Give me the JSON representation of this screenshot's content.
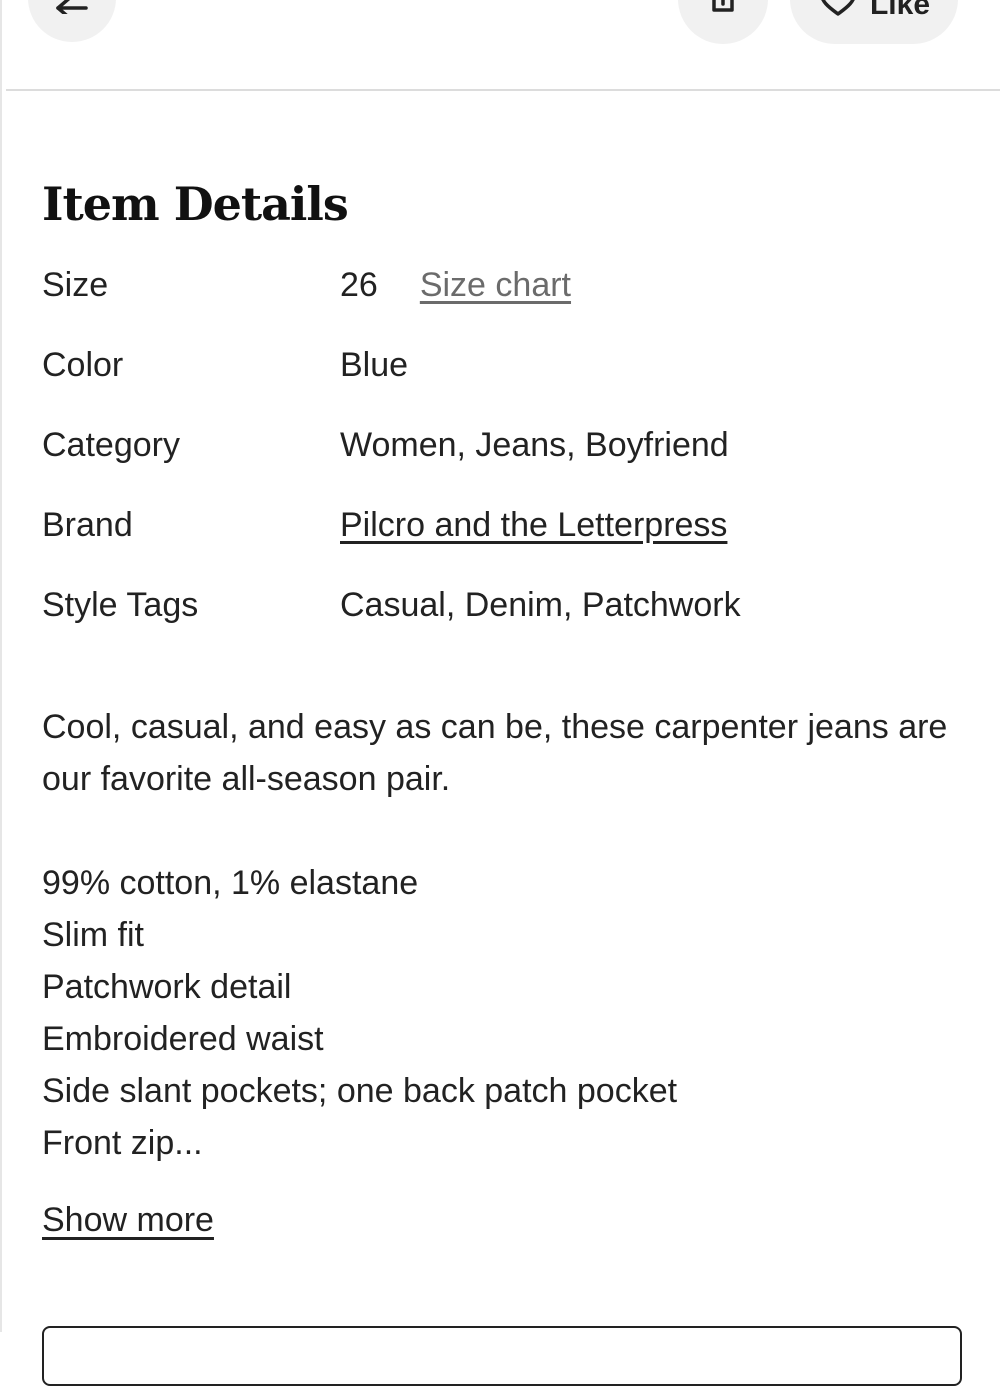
{
  "header": {
    "like_label": "Like"
  },
  "item_details": {
    "title": "Item Details",
    "rows": [
      {
        "label": "Size",
        "value": "26",
        "link": "Size chart"
      },
      {
        "label": "Color",
        "value": "Blue"
      },
      {
        "label": "Category",
        "value": "Women, Jeans, Boyfriend"
      },
      {
        "label": "Brand",
        "value": "Pilcro and the Letterpress"
      },
      {
        "label": "Style Tags",
        "value": "Casual, Denim, Patchwork"
      }
    ]
  },
  "description": {
    "intro": "Cool, casual, and easy as can be, these carpenter jeans are our favorite all-season pair.",
    "bullets": [
      "99% cotton, 1% elastane",
      "Slim fit",
      "Patchwork detail",
      "Embroidered waist",
      "Side slant pockets; one back patch pocket",
      "Front zip..."
    ],
    "show_more": "Show more"
  }
}
